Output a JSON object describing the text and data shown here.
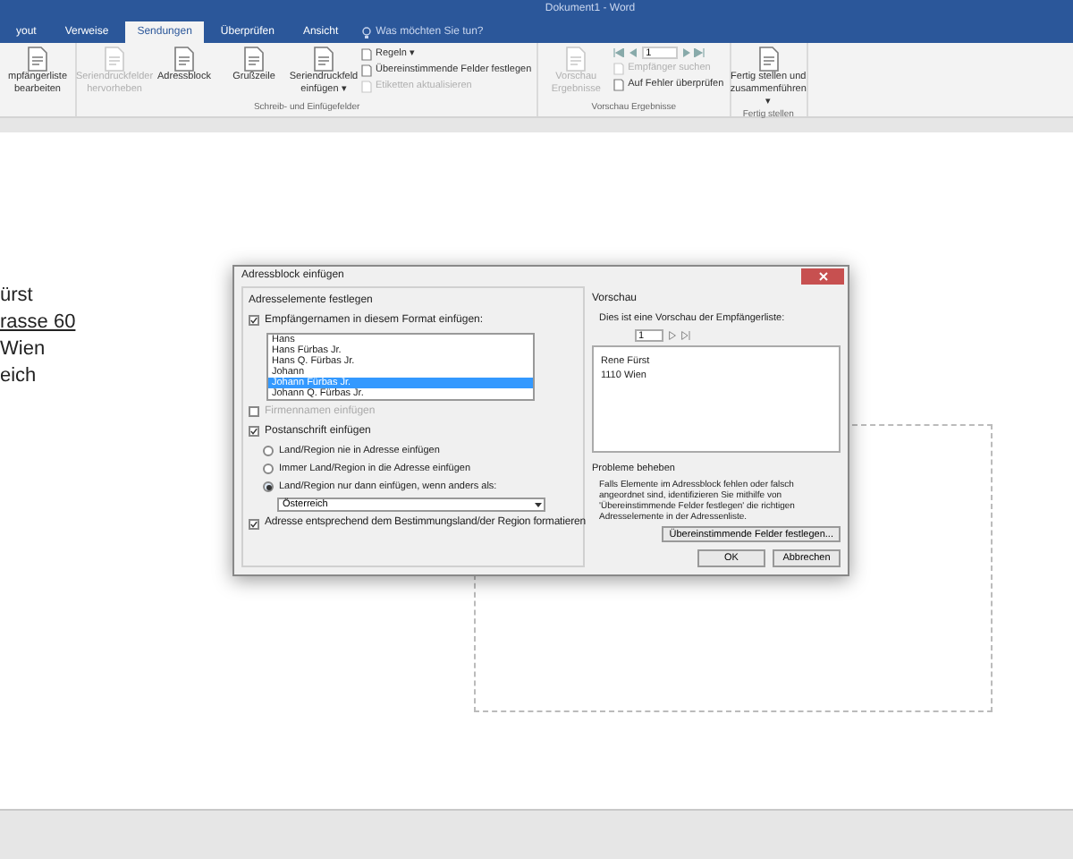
{
  "window": {
    "title": "Dokument1 - Word"
  },
  "tabs": [
    {
      "label": "yout",
      "selected": false
    },
    {
      "label": "Verweise",
      "selected": false
    },
    {
      "label": "Sendungen",
      "selected": true
    },
    {
      "label": "Überprüfen",
      "selected": false
    },
    {
      "label": "Ansicht",
      "selected": false
    }
  ],
  "tell_me": {
    "placeholder": "Was möchten Sie tun?"
  },
  "ribbon": {
    "groups": [
      {
        "items": [
          {
            "kind": "large",
            "label": "mpfängerliste bearbeiten",
            "disabled": false
          }
        ]
      },
      {
        "label": "Schreib- und Einfügefelder",
        "items": [
          {
            "kind": "large",
            "label": "Seriendruckfelder hervorheben",
            "disabled": true
          },
          {
            "kind": "large",
            "label": "Adressblock",
            "disabled": false
          },
          {
            "kind": "large",
            "label": "Grußzeile",
            "disabled": false
          },
          {
            "kind": "large",
            "label": "Seriendruckfeld einfügen ▾",
            "disabled": false
          },
          {
            "kind": "stack",
            "items": [
              {
                "label": "Regeln ▾",
                "disabled": false
              },
              {
                "label": "Übereinstimmende Felder festlegen",
                "disabled": false
              },
              {
                "label": "Etiketten aktualisieren",
                "disabled": true
              }
            ]
          }
        ]
      },
      {
        "label": "Vorschau Ergebnisse",
        "items": [
          {
            "kind": "large",
            "label": "Vorschau Ergebnisse",
            "disabled": true
          },
          {
            "kind": "nav",
            "record": "1",
            "items": [
              {
                "label": "Empfänger suchen",
                "disabled": true
              },
              {
                "label": "Auf Fehler überprüfen",
                "disabled": false
              }
            ]
          }
        ]
      },
      {
        "label": "Fertig stellen",
        "items": [
          {
            "kind": "large",
            "label": "Fertig stellen und zusammenführen ▾",
            "disabled": false
          }
        ]
      }
    ]
  },
  "document": {
    "lines": [
      {
        "text": "ürst",
        "underline": false
      },
      {
        "text": "rasse 60",
        "underline": true
      },
      {
        "text": "Wien",
        "underline": false
      },
      {
        "text": "eich",
        "underline": false
      }
    ]
  },
  "dialog": {
    "title": "Adressblock einfügen",
    "left_title": "Adresselemente festlegen",
    "names_checkbox": {
      "label": "Empfängernamen in diesem Format einfügen:",
      "checked": true
    },
    "name_formats": [
      {
        "text": "Hans",
        "selected": false
      },
      {
        "text": "Hans Fürbas Jr.",
        "selected": false
      },
      {
        "text": "Hans Q. Fürbas Jr.",
        "selected": false
      },
      {
        "text": "Johann",
        "selected": false
      },
      {
        "text": "Johann Fürbas Jr.",
        "selected": true
      },
      {
        "text": "Johann Q. Fürbas Jr.",
        "selected": false
      }
    ],
    "company_checkbox": {
      "label": "Firmennamen einfügen",
      "checked": false,
      "disabled": true
    },
    "postal_checkbox": {
      "label": "Postanschrift einfügen",
      "checked": true
    },
    "country_options": [
      {
        "label": "Land/Region nie in Adresse einfügen",
        "selected": false
      },
      {
        "label": "Immer Land/Region in die Adresse einfügen",
        "selected": false
      },
      {
        "label": "Land/Region nur dann einfügen, wenn anders als:",
        "selected": true
      }
    ],
    "country": "Österreich",
    "format_checkbox": {
      "label": "Adresse entsprechend dem Bestimmungsland/der Region formatieren",
      "checked": true
    },
    "preview_title": "Vorschau",
    "preview_caption": "Dies ist eine Vorschau der Empfängerliste:",
    "preview_record": "1",
    "preview_lines": [
      "Rene Fürst",
      "1110 Wien"
    ],
    "problems_title": "Probleme beheben",
    "problems_text": "Falls Elemente im Adressblock fehlen oder falsch angeordnet sind, identifizieren Sie mithilfe von 'Übereinstimmende Felder festlegen' die richtigen Adresselemente in der Adressenliste.",
    "match_button": "Übereinstimmende Felder festlegen...",
    "buttons": [
      "OK",
      "Abbrechen"
    ]
  }
}
